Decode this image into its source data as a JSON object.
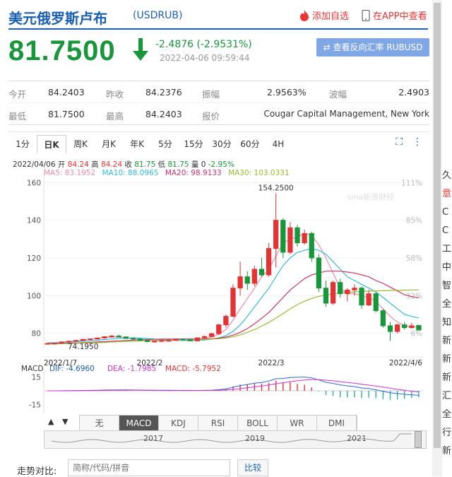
{
  "header": {
    "title": "美元俄罗斯卢布",
    "code": "(USDRUB)",
    "add_fav": "添加自选",
    "app_view": "在APP中查看",
    "price": "81.7500",
    "change": "-2.4876 (-2.9531%)",
    "time": "2022-04-06 09:59:44",
    "reverse_button": "⇄ 查看反向汇率 RUBUSD"
  },
  "stats": {
    "row1": [
      {
        "label": "今开",
        "value": "84.2403"
      },
      {
        "label": "昨收",
        "value": "84.2376"
      },
      {
        "label": "振幅",
        "value": "2.9563%"
      },
      {
        "label": "波幅",
        "value": "2.4903"
      }
    ],
    "row2": [
      {
        "label": "最低",
        "value": "81.7500"
      },
      {
        "label": "最高",
        "value": "84.2403"
      },
      {
        "label": "报价",
        "value": "Cougar Capital Management, New York"
      }
    ]
  },
  "tabs": [
    "1分",
    "日K",
    "周K",
    "月K",
    "年K",
    "5分",
    "15分",
    "30分",
    "60分",
    "4H"
  ],
  "active_tab": "日K",
  "info": {
    "date": "2022/04/06",
    "open_lbl": "开",
    "open": "84.24",
    "high_lbl": "高",
    "high": "84.24",
    "close_lbl": "收",
    "close": "81.75",
    "low_lbl": "低",
    "low": "81.75",
    "vol_lbl": "量",
    "vol": "0",
    "chg": "-2.95%",
    "ma5": "MA5: 83.1952",
    "ma10": "MA10: 88.0965",
    "ma20": "MA20: 98.9133",
    "ma30": "MA30: 103.0331"
  },
  "colors": {
    "up": "#e33333",
    "down": "#17963a",
    "ma5": "#f08aa8",
    "ma10": "#33bbdd",
    "ma20": "#cc3366",
    "ma30": "#99bb33",
    "brand": "#1a5fb4"
  },
  "chart_data": {
    "type": "candlestick",
    "y_ticks": [
      160,
      140,
      120,
      100,
      80
    ],
    "ylim": [
      72,
      162
    ],
    "pct_ticks": [
      "111%",
      "85%",
      "58%",
      "32%",
      "6%"
    ],
    "x_ticks": [
      "2022/1/7",
      "2022/2",
      "2022/3",
      "2022/4/6"
    ],
    "max_label": "154.2500",
    "min_label": "74.1950",
    "candles": [
      [
        74.5,
        74.9,
        74.2,
        74.6
      ],
      [
        74.6,
        75.0,
        74.3,
        74.7
      ],
      [
        74.7,
        75.6,
        74.5,
        75.4
      ],
      [
        75.4,
        76.1,
        75.0,
        75.8
      ],
      [
        75.8,
        76.4,
        75.4,
        76.2
      ],
      [
        76.2,
        77.0,
        75.9,
        76.8
      ],
      [
        76.8,
        77.4,
        76.3,
        77.0
      ],
      [
        77.0,
        77.8,
        76.6,
        77.5
      ],
      [
        77.5,
        78.5,
        77.1,
        78.2
      ],
      [
        78.2,
        79.0,
        77.6,
        78.6
      ],
      [
        78.6,
        79.3,
        77.9,
        78.1
      ],
      [
        78.1,
        78.4,
        77.0,
        77.3
      ],
      [
        77.3,
        77.9,
        76.6,
        77.0
      ],
      [
        77.0,
        77.3,
        75.9,
        76.2
      ],
      [
        76.2,
        76.7,
        75.3,
        75.6
      ],
      [
        75.6,
        76.2,
        75.0,
        75.8
      ],
      [
        75.8,
        76.6,
        75.3,
        76.1
      ],
      [
        76.1,
        76.7,
        75.7,
        76.2
      ],
      [
        76.2,
        77.2,
        75.9,
        76.9
      ],
      [
        76.9,
        77.4,
        76.3,
        76.6
      ],
      [
        76.6,
        77.1,
        75.9,
        76.0
      ],
      [
        76.0,
        77.8,
        75.8,
        77.6
      ],
      [
        77.6,
        78.8,
        77.2,
        78.3
      ],
      [
        78.3,
        80.2,
        78.0,
        79.8
      ],
      [
        79.8,
        85.0,
        79.0,
        84.5
      ],
      [
        84.5,
        90.0,
        83.0,
        89.0
      ],
      [
        89.0,
        106.0,
        88.5,
        104.0
      ],
      [
        104.0,
        118.0,
        100.0,
        110.0
      ],
      [
        110.0,
        113.0,
        103.0,
        106.5
      ],
      [
        106.5,
        116.0,
        105.0,
        114.0
      ],
      [
        114.0,
        120.0,
        110.0,
        111.0
      ],
      [
        111.0,
        128.0,
        110.0,
        125.0
      ],
      [
        125.0,
        154.25,
        115.0,
        140.0
      ],
      [
        140.0,
        141.0,
        120.0,
        123.0
      ],
      [
        123.0,
        139.0,
        122.0,
        136.0
      ],
      [
        136.0,
        137.5,
        126.0,
        128.0
      ],
      [
        128.0,
        135.0,
        127.0,
        133.0
      ],
      [
        133.0,
        134.0,
        118.0,
        120.0
      ],
      [
        120.0,
        122.0,
        102.0,
        104.0
      ],
      [
        104.0,
        108.0,
        94.0,
        96.0
      ],
      [
        96.0,
        108.0,
        95.0,
        107.0
      ],
      [
        107.0,
        109.0,
        99.0,
        101.0
      ],
      [
        101.0,
        104.0,
        97.0,
        103.0
      ],
      [
        103.0,
        106.0,
        100.0,
        104.0
      ],
      [
        104.0,
        105.0,
        93.0,
        95.0
      ],
      [
        95.0,
        103.0,
        94.5,
        101.0
      ],
      [
        101.0,
        102.0,
        91.0,
        92.0
      ],
      [
        92.0,
        93.0,
        83.0,
        84.0
      ],
      [
        84.0,
        86.0,
        76.0,
        81.0
      ],
      [
        81.0,
        85.0,
        80.0,
        84.5
      ],
      [
        84.5,
        86.0,
        82.0,
        83.0
      ],
      [
        83.0,
        85.5,
        82.5,
        84.0
      ],
      [
        84.24,
        84.24,
        81.75,
        81.75
      ]
    ],
    "ma": {
      "MA5": [
        75,
        75.1,
        75.3,
        75.6,
        76,
        76.5,
        77,
        77.4,
        77.8,
        78,
        78,
        77.7,
        77.3,
        76.9,
        76.4,
        76.1,
        76,
        76.1,
        76.4,
        76.6,
        76.5,
        76.8,
        77.2,
        78,
        79.5,
        82,
        87,
        93,
        98.5,
        104,
        110,
        114,
        121,
        128,
        130,
        131,
        133,
        132,
        127,
        120,
        112,
        104,
        101,
        101,
        100,
        99,
        97,
        93,
        89,
        86,
        84,
        83.5,
        83.2
      ],
      "MA10": [
        74.8,
        74.9,
        75.1,
        75.3,
        75.5,
        75.8,
        76.1,
        76.4,
        76.7,
        77,
        77.3,
        77.5,
        77.6,
        77.5,
        77.3,
        77,
        76.7,
        76.5,
        76.3,
        76.2,
        76.2,
        76.3,
        76.5,
        76.9,
        77.6,
        78.8,
        81,
        84.5,
        89,
        94,
        99,
        104,
        110,
        116,
        120,
        123,
        124,
        125,
        124,
        122,
        118,
        114,
        110,
        108,
        106,
        104,
        102,
        99,
        96,
        93,
        90,
        89,
        88.1
      ],
      "MA20": [
        74.5,
        74.6,
        74.7,
        74.8,
        74.9,
        75,
        75.2,
        75.4,
        75.6,
        75.8,
        76,
        76.2,
        76.4,
        76.6,
        76.7,
        76.8,
        76.9,
        76.9,
        77,
        77,
        77,
        77,
        77,
        77.1,
        77.4,
        78,
        79,
        80.5,
        82.5,
        85,
        88,
        91,
        95,
        99,
        103,
        106,
        109,
        111,
        112,
        113,
        113,
        113,
        112.5,
        112,
        111,
        110,
        108,
        106.5,
        104.5,
        102.5,
        100.5,
        99.5,
        98.9
      ],
      "MA30": [
        74.3,
        74.4,
        74.5,
        74.6,
        74.7,
        74.8,
        74.9,
        75,
        75.2,
        75.4,
        75.5,
        75.7,
        75.8,
        76,
        76.1,
        76.2,
        76.3,
        76.4,
        76.5,
        76.6,
        76.6,
        76.7,
        76.8,
        76.9,
        77.1,
        77.5,
        78.2,
        79.2,
        80.5,
        82,
        83.8,
        85.8,
        88,
        90.5,
        93,
        95.2,
        97,
        98.5,
        99.6,
        100.4,
        101,
        101.4,
        101.8,
        102,
        102.2,
        102.4,
        102.5,
        102.6,
        102.7,
        102.8,
        102.9,
        103,
        103.03
      ]
    },
    "macd": {
      "label": "MACD",
      "dif": "DIF: -4.6960",
      "dea": "DEA: -1.7985",
      "macd": "MACD: -5.7952",
      "y_ticks": [
        15,
        -15
      ],
      "ylim": [
        -20,
        20
      ]
    }
  },
  "indicators": [
    "无",
    "MACD",
    "KDJ",
    "RSI",
    "BOLL",
    "WR",
    "DMI"
  ],
  "active_indicator": "MACD",
  "slider_years": [
    "2017",
    "2019",
    "2021"
  ],
  "compare": {
    "label": "走势对比:",
    "placeholder": "简称/代码/拼音",
    "button": "比较"
  },
  "sidebar_chars": [
    "久",
    "意",
    "C",
    "C",
    "工",
    "中",
    "智",
    "全",
    "知",
    "新",
    "新",
    "新",
    "汇",
    "全",
    "行",
    "新"
  ]
}
